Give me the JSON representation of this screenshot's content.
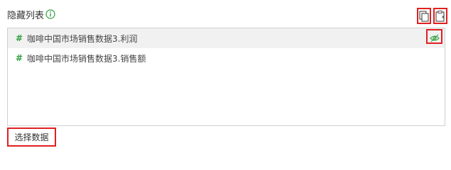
{
  "header": {
    "title": "隐藏列表",
    "info_icon": "info-circle-icon",
    "copy_icon": "copy-icon",
    "paste_icon": "paste-icon"
  },
  "list": {
    "items": [
      {
        "type_icon": "#",
        "label": "咖啡中国市场销售数据3.利润",
        "visibility_icon": "eye-hidden-icon",
        "selected": true
      },
      {
        "type_icon": "#",
        "label": "咖啡中国市场销售数据3.销售额",
        "selected": false
      }
    ]
  },
  "footer": {
    "select_data_label": "选择数据"
  },
  "colors": {
    "accent_green": "#2f9e3e",
    "highlight_red": "#e02020",
    "border": "#d0d0d0"
  }
}
